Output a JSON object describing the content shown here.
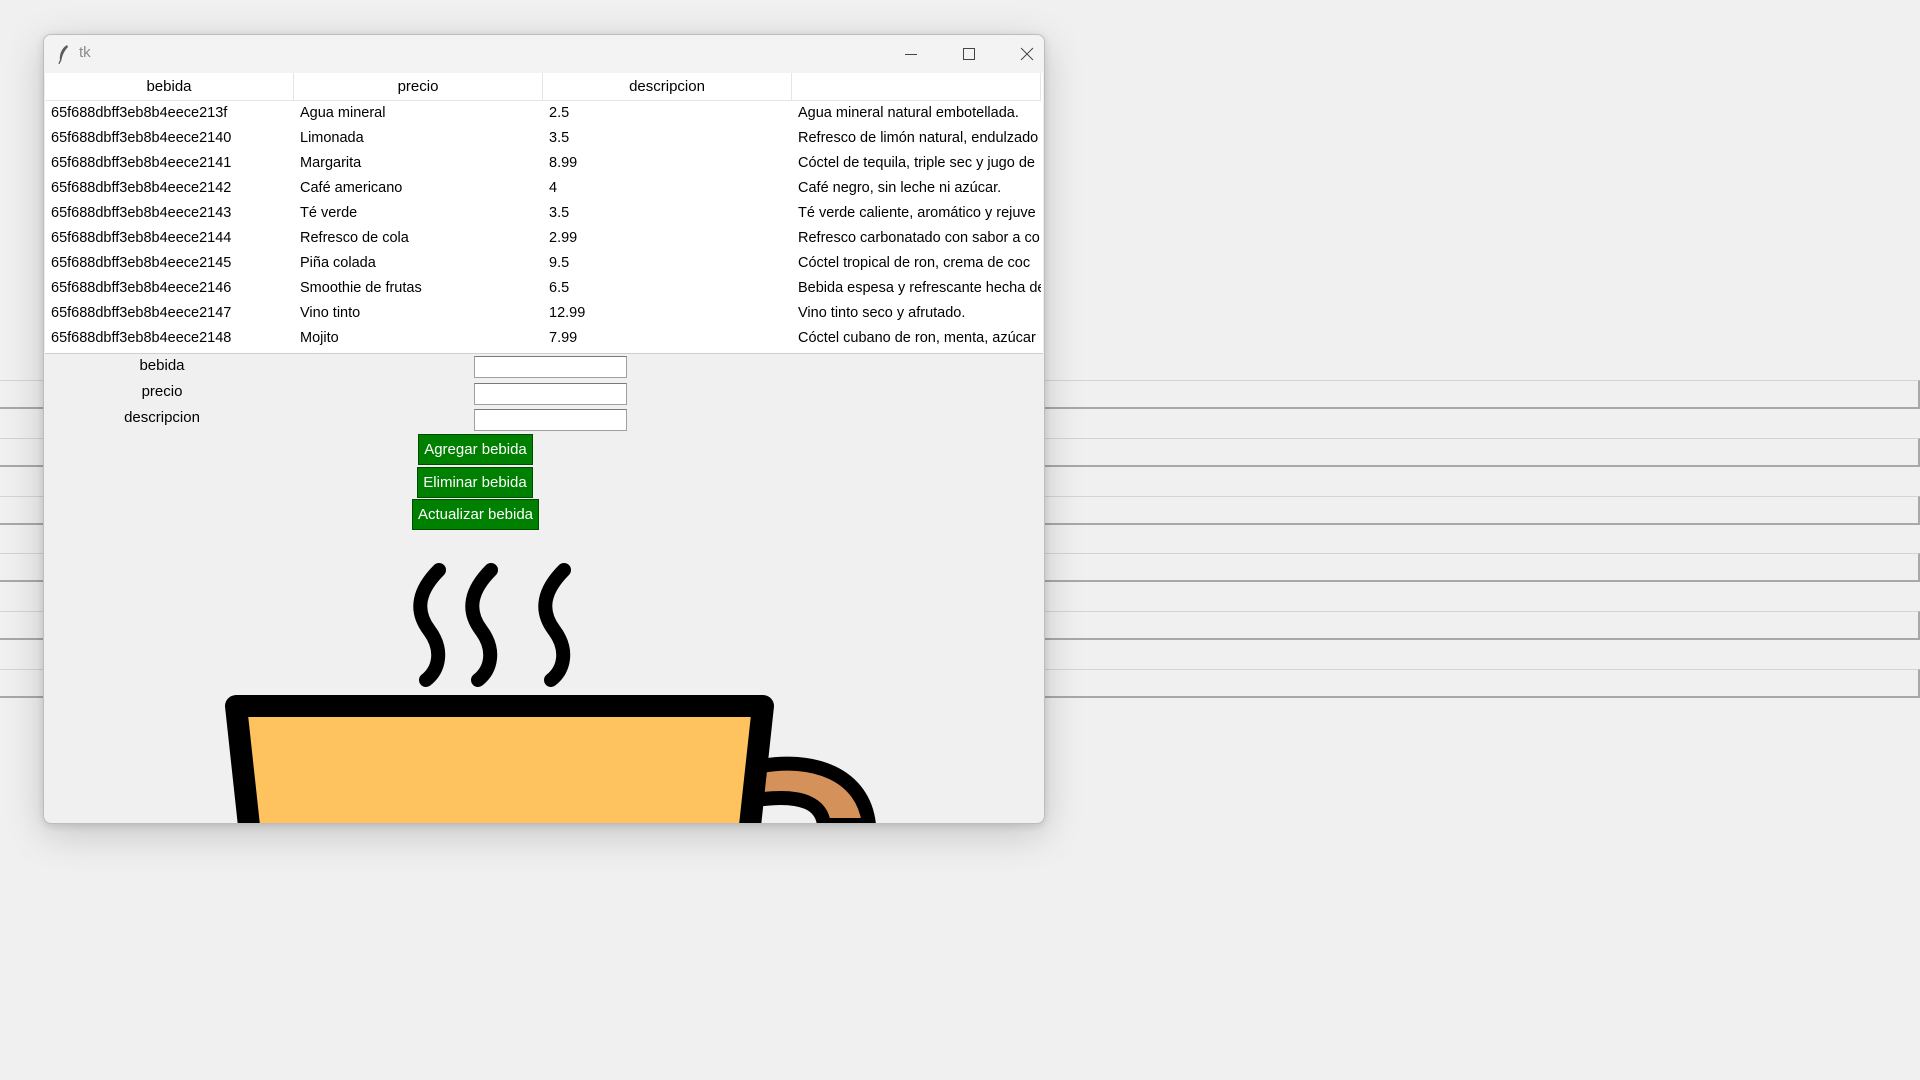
{
  "window": {
    "title": "tk"
  },
  "tree": {
    "columns": [
      "bebida",
      "precio",
      "descripcion",
      ""
    ],
    "rows": [
      [
        "65f688dbff3eb8b4eece213f",
        "Agua mineral",
        "2.5",
        "Agua mineral natural embotellada."
      ],
      [
        "65f688dbff3eb8b4eece2140",
        "Limonada",
        "3.5",
        "Refresco de limón natural, endulzado"
      ],
      [
        "65f688dbff3eb8b4eece2141",
        "Margarita",
        "8.99",
        "Cóctel de tequila, triple sec y jugo de"
      ],
      [
        "65f688dbff3eb8b4eece2142",
        "Café americano",
        "4",
        "Café negro, sin leche ni azúcar."
      ],
      [
        "65f688dbff3eb8b4eece2143",
        "Té verde",
        "3.5",
        "Té verde caliente, aromático y rejuve"
      ],
      [
        "65f688dbff3eb8b4eece2144",
        "Refresco de cola",
        "2.99",
        "Refresco carbonatado con sabor a co"
      ],
      [
        "65f688dbff3eb8b4eece2145",
        "Piña colada",
        "9.5",
        "Cóctel tropical de ron, crema de coc"
      ],
      [
        "65f688dbff3eb8b4eece2146",
        "Smoothie de frutas",
        "6.5",
        "Bebida espesa y refrescante hecha de"
      ],
      [
        "65f688dbff3eb8b4eece2147",
        "Vino tinto",
        "12.99",
        "Vino tinto seco y afrutado."
      ],
      [
        "65f688dbff3eb8b4eece2148",
        "Mojito",
        "7.99",
        "Cóctel cubano de ron, menta, azúcar"
      ]
    ]
  },
  "form": {
    "bebida_label": "bebida",
    "precio_label": "precio",
    "descripcion_label": "descripcion",
    "bebida_value": "",
    "precio_value": "",
    "descripcion_value": ""
  },
  "buttons": {
    "agregar": "Agregar bebida",
    "eliminar": "Eliminar bebida",
    "actualizar": "Actualizar bebida"
  },
  "icons": [
    "tk-feather-icon",
    "minimize-icon",
    "maximize-icon",
    "close-icon",
    "coffee-cup-icon"
  ],
  "colors": {
    "button_bg": "#008000",
    "button_text": "#ffffff",
    "cup_fill": "#fec25e",
    "cup_handle": "#d4915a",
    "cup_outline": "#000000"
  }
}
